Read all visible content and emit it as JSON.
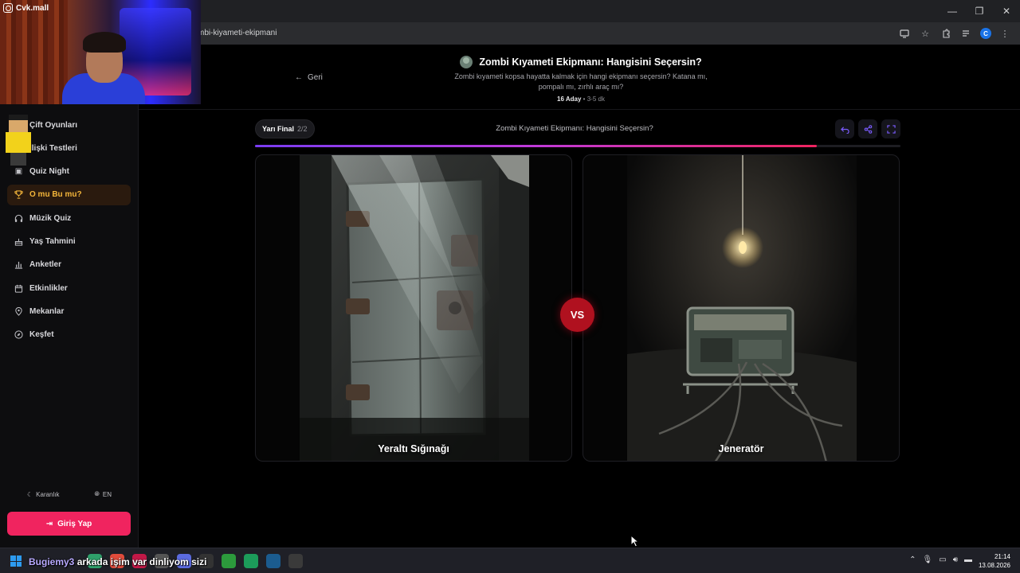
{
  "browser": {
    "url": "mbi-kiyameti-ekipmani",
    "window_controls": [
      "—",
      "❐",
      "✕"
    ]
  },
  "webcam": {
    "label": "Cvk.mall"
  },
  "sidebar": {
    "items": [
      {
        "label": "Çift Oyunları",
        "icon": "heart-icon"
      },
      {
        "label": "İlişki Testleri",
        "icon": "heart-check-icon"
      },
      {
        "label": "Quiz Night",
        "icon": "gamepad-icon"
      },
      {
        "label": "O mu Bu mu?",
        "icon": "trophy-icon",
        "active": true
      },
      {
        "label": "Müzik Quiz",
        "icon": "headphones-icon"
      },
      {
        "label": "Yaş Tahmini",
        "icon": "cake-icon"
      },
      {
        "label": "Anketler",
        "icon": "bar-chart-icon"
      },
      {
        "label": "Etkinlikler",
        "icon": "calendar-icon"
      },
      {
        "label": "Mekanlar",
        "icon": "map-pin-icon"
      },
      {
        "label": "Keşfet",
        "icon": "compass-icon"
      }
    ],
    "theme_toggle": "Karanlık",
    "language": "EN",
    "login_label": "Giriş Yap"
  },
  "header": {
    "back_label": "Geri",
    "title": "Zombi Kıyameti Ekipmanı: Hangisini Seçersin?",
    "subtitle": "Zombi kıyameti kopsa hayatta kalmak için hangi ekipmanı seçersin? Katana mı, pompalı mı, zırhlı araç mı?",
    "candidates": "16 Aday",
    "duration": "3-5 dk"
  },
  "round": {
    "name": "Yarı Final",
    "count": "2/2",
    "title": "Zombi Kıyameti Ekipmanı: Hangisini Seçersin?",
    "progress_fraction": 0.87
  },
  "matchup": {
    "left_label": "Yeraltı Sığınağı",
    "right_label": "Jeneratör",
    "vs": "VS"
  },
  "taskbar": {
    "chat_user": "Bugiemy3",
    "chat_message": "arkada işim var dinliyom sizi",
    "time": "21:14",
    "date": "13.08.2026"
  },
  "colors": {
    "accent": "#f0245f",
    "active_nav": "#f3b53a",
    "vs": "#b0111f"
  }
}
